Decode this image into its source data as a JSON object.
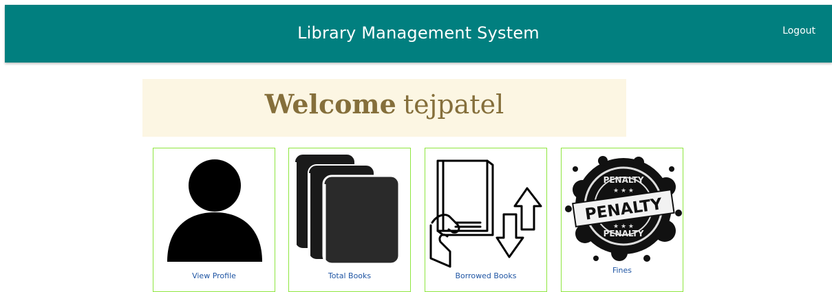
{
  "header": {
    "title": "Library Management System",
    "logout_label": "Logout"
  },
  "welcome": {
    "greeting": "Welcome",
    "username": "tejpatel"
  },
  "cards": [
    {
      "label": "View Profile",
      "icon": "user-icon"
    },
    {
      "label": "Total Books",
      "icon": "books-stack-icon"
    },
    {
      "label": "Borrowed Books",
      "icon": "borrow-book-icon"
    },
    {
      "label": "Fines",
      "icon": "penalty-stamp-icon"
    }
  ],
  "penalty_stamp": {
    "main": "PENALTY",
    "ring_top": "PENALTY",
    "ring_bottom": "PENALTY"
  },
  "colors": {
    "header_bg": "#017f7f",
    "welcome_bg": "#fcf6e3",
    "welcome_text": "#856f3b",
    "card_border": "#8ee63f",
    "card_label": "#1f55a3"
  }
}
